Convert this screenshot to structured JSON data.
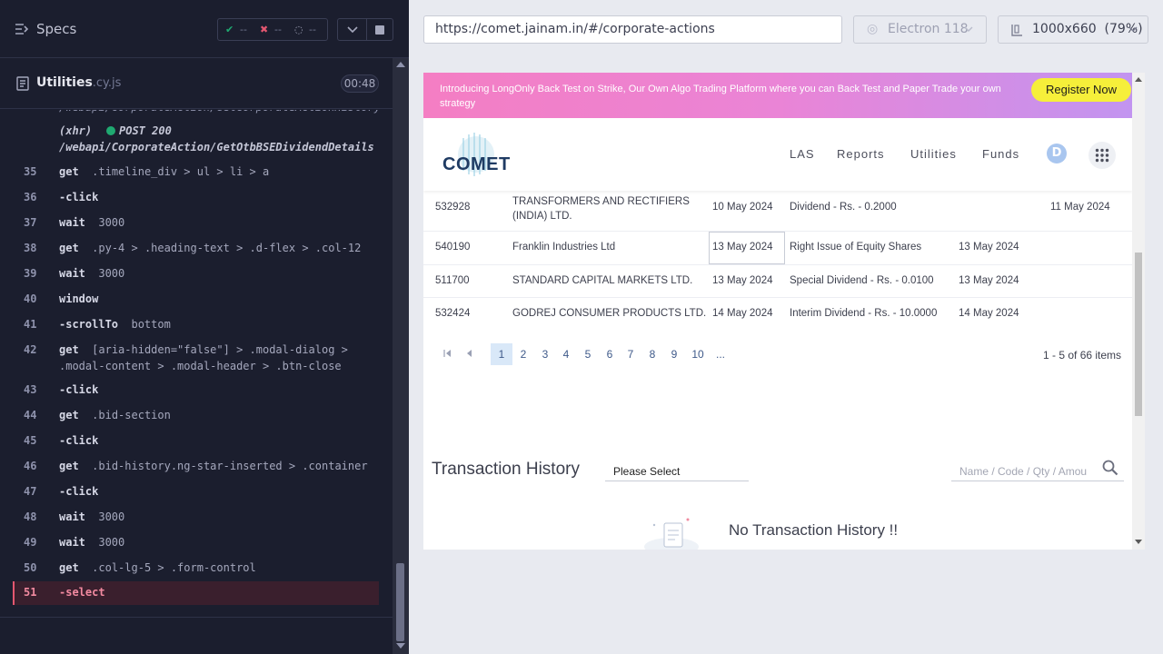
{
  "specs": {
    "label": "Specs"
  },
  "stats": {
    "passed": "--",
    "failed": "--",
    "pending": "--"
  },
  "file": {
    "name": "Utilities",
    "ext": ".cy.js",
    "timer": "00:48"
  },
  "commands": [
    {
      "num": "",
      "name": "(xhr)",
      "args": "POST 200",
      "arg2": "/webapi/CorporateAction/GetOtbBSEDividendDetails"
    },
    {
      "num": "35",
      "name": "get",
      "args": ".timeline_div > ul > li > a"
    },
    {
      "num": "36",
      "name": "-click",
      "args": ""
    },
    {
      "num": "37",
      "name": "wait",
      "args": "3000"
    },
    {
      "num": "38",
      "name": "get",
      "args": ".py-4 > .heading-text > .d-flex > .col-12"
    },
    {
      "num": "39",
      "name": "wait",
      "args": "3000"
    },
    {
      "num": "40",
      "name": "window",
      "args": ""
    },
    {
      "num": "41",
      "name": "-scrollTo",
      "args": "bottom"
    },
    {
      "num": "42",
      "name": "get",
      "args": "[aria-hidden=\"false\"] > .modal-dialog >",
      "arg2": ".modal-content > .modal-header > .btn-close"
    },
    {
      "num": "43",
      "name": "-click",
      "args": ""
    },
    {
      "num": "44",
      "name": "get",
      "args": ".bid-section"
    },
    {
      "num": "45",
      "name": "-click",
      "args": ""
    },
    {
      "num": "46",
      "name": "get",
      "args": ".bid-history.ng-star-inserted > .container"
    },
    {
      "num": "47",
      "name": "-click",
      "args": ""
    },
    {
      "num": "48",
      "name": "wait",
      "args": "3000"
    },
    {
      "num": "49",
      "name": "wait",
      "args": "3000"
    },
    {
      "num": "50",
      "name": "get",
      "args": ".col-lg-5 > .form-control"
    },
    {
      "num": "51",
      "name": "-select",
      "args": ""
    }
  ],
  "browser": {
    "url": "https://comet.jainam.in/#/corporate-actions",
    "engine": "Electron 118",
    "viewport": "1000x660  (79%)"
  },
  "banner": {
    "text": "Introducing LongOnly Back Test on Strike, Our Own Algo Trading Platform where you can Back Test and Paper Trade your own strategy",
    "cta": "Register Now"
  },
  "nav": {
    "logo": "COMET",
    "links": [
      "LAS",
      "Reports",
      "Utilities",
      "Funds"
    ],
    "avatar": "D"
  },
  "table": {
    "rows": [
      {
        "code": "532928",
        "name": "TRANSFORMERS AND RECTIFIERS (INDIA) LTD.",
        "ex_date": "10 May 2024",
        "purpose": "Dividend - Rs. - 0.2000",
        "record": "",
        "bc": "11 May 2024"
      },
      {
        "code": "540190",
        "name": "Franklin Industries Ltd",
        "ex_date": "13 May 2024",
        "purpose": "Right Issue of Equity Shares",
        "record": "13 May 2024",
        "bc": ""
      },
      {
        "code": "511700",
        "name": "STANDARD CAPITAL MARKETS LTD.",
        "ex_date": "13 May 2024",
        "purpose": "Special Dividend - Rs. - 0.0100",
        "record": "13 May 2024",
        "bc": ""
      },
      {
        "code": "532424",
        "name": "GODREJ CONSUMER PRODUCTS LTD.",
        "ex_date": "14 May 2024",
        "purpose": "Interim Dividend - Rs. - 10.0000",
        "record": "14 May 2024",
        "bc": ""
      }
    ]
  },
  "pager": {
    "pages": [
      "1",
      "2",
      "3",
      "4",
      "5",
      "6",
      "7",
      "8",
      "9",
      "10",
      "..."
    ],
    "active": "1",
    "info": "1 - 5 of 66 items"
  },
  "transactions": {
    "title": "Transaction History",
    "select_value": "Please Select",
    "search_placeholder": "Name / Code / Qty / Amou",
    "empty": "No Transaction History !!"
  }
}
